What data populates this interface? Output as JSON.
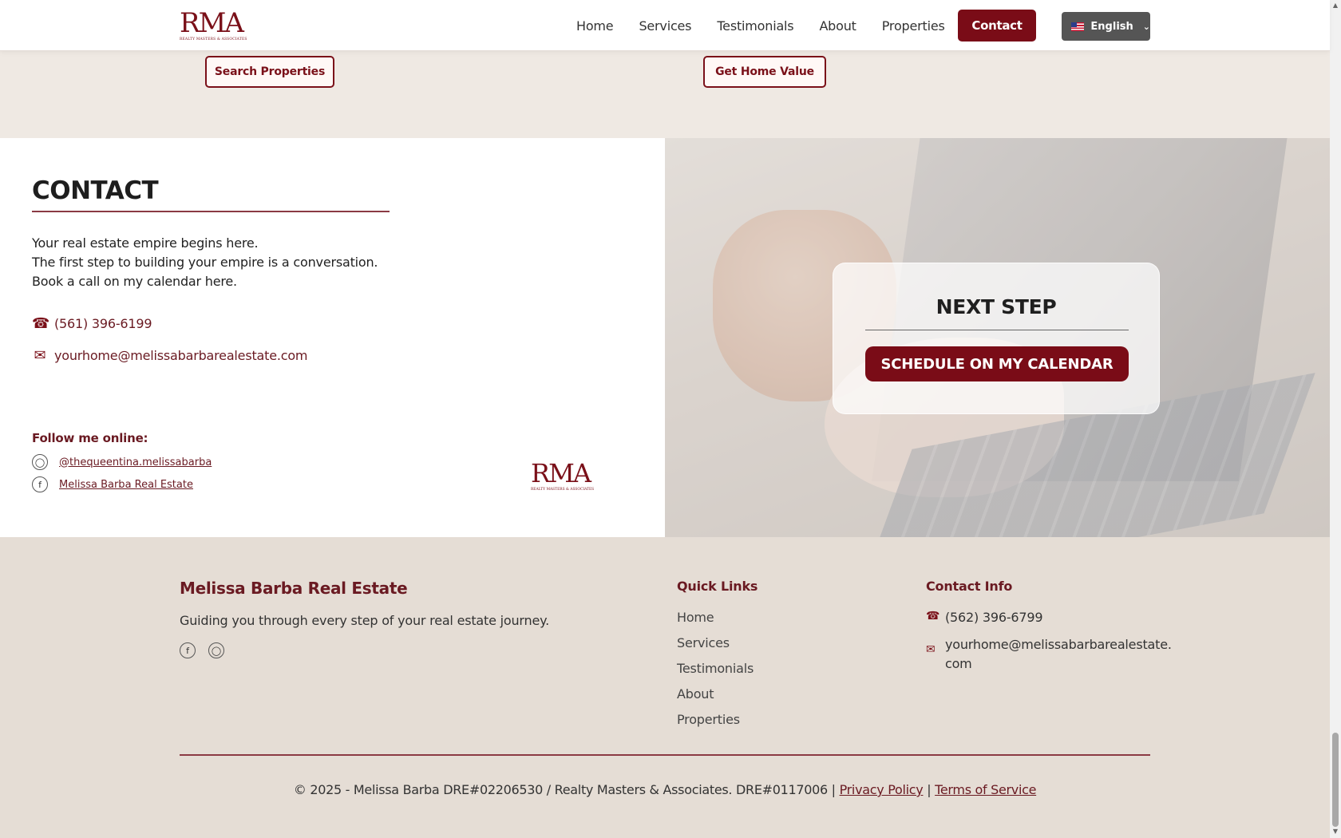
{
  "header": {
    "logo": {
      "mark": "RMA",
      "subtitle": "REALTY MASTERS & ASSOCIATES"
    },
    "nav": [
      "Home",
      "Services",
      "Testimonials",
      "About",
      "Properties"
    ],
    "contact_label": "Contact",
    "language": "English"
  },
  "top_section": {
    "search_label": "Search Properties",
    "home_value_label": "Get Home Value"
  },
  "contact": {
    "title": "CONTACT",
    "lines": [
      "Your real estate empire begins here.",
      "The first step to building your empire is a conversation.",
      "Book a call on my calendar here."
    ],
    "phone": "(561) 396-6199",
    "email": "yourhome@melissabarbarealestate.com",
    "follow_label": "Follow me online:",
    "instagram": "@thequeentina.melissabarba",
    "facebook": "Melissa Barba Real Estate",
    "logo": {
      "mark": "RMA",
      "subtitle": "REALTY MASTERS & ASSOCIATES"
    }
  },
  "next_step": {
    "title": "NEXT STEP",
    "button_label": "SCHEDULE ON MY CALENDAR"
  },
  "footer": {
    "brand": "Melissa Barba Real Estate",
    "tagline": "Guiding you through every step of your real estate journey.",
    "quick_links_title": "Quick Links",
    "quick_links": [
      "Home",
      "Services",
      "Testimonials",
      "About",
      "Properties"
    ],
    "contact_info_title": "Contact Info",
    "phone": "(562) 396-6799",
    "email_line1": "yourhome@melissabarbarealestate.",
    "email_line2": "com",
    "copyright": "© 2025 - Melissa Barba DRE#02206530 / Realty Masters & Associates. DRE#0117006 |",
    "privacy": "Privacy Policy",
    "separator": "|",
    "terms": "Terms of Service"
  },
  "colors": {
    "brand": "#7a0c17",
    "footer_bg": "#e5ddd5",
    "section_bg": "#efe9e3"
  },
  "icons": [
    "phone-icon",
    "mail-icon",
    "instagram-icon",
    "facebook-icon",
    "chevron-down-icon",
    "us-flag-icon"
  ]
}
